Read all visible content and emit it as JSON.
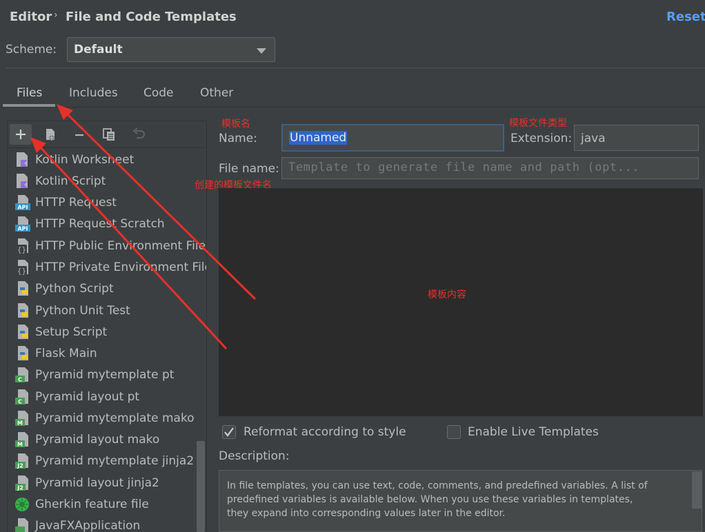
{
  "header": {
    "breadcrumb": [
      "Editor",
      "File and Code Templates"
    ],
    "breadcrumb_separator": "›",
    "reset_label": "Reset"
  },
  "scheme": {
    "label": "Scheme:",
    "value": "Default"
  },
  "tabs": [
    {
      "label": "Files",
      "active": true
    },
    {
      "label": "Includes",
      "active": false
    },
    {
      "label": "Code",
      "active": false
    },
    {
      "label": "Other",
      "active": false
    }
  ],
  "toolbar": {
    "buttons": [
      {
        "name": "add-template-button",
        "glyph": "+"
      },
      {
        "name": "add-child-template-button",
        "glyph": "▟"
      },
      {
        "name": "remove-template-button",
        "glyph": "−"
      },
      {
        "name": "copy-template-button",
        "glyph": "⧉"
      },
      {
        "name": "revert-template-button",
        "glyph": "↶"
      }
    ]
  },
  "templates": [
    {
      "label": "Kotlin Worksheet",
      "icon": "kotlin-file-icon"
    },
    {
      "label": "Kotlin Script",
      "icon": "kotlin-file-icon"
    },
    {
      "label": "HTTP Request",
      "icon": "api-file-icon"
    },
    {
      "label": "HTTP Request Scratch",
      "icon": "api-file-icon"
    },
    {
      "label": "HTTP Public Environment File",
      "icon": "json-file-icon"
    },
    {
      "label": "HTTP Private Environment File",
      "icon": "json-file-icon"
    },
    {
      "label": "Python Script",
      "icon": "python-file-icon"
    },
    {
      "label": "Python Unit Test",
      "icon": "python-file-icon"
    },
    {
      "label": "Setup Script",
      "icon": "python-file-icon"
    },
    {
      "label": "Flask Main",
      "icon": "python-file-icon"
    },
    {
      "label": "Pyramid mytemplate pt",
      "icon": "chameleon-file-icon",
      "badge": "C"
    },
    {
      "label": "Pyramid layout pt",
      "icon": "chameleon-file-icon",
      "badge": "C"
    },
    {
      "label": "Pyramid mytemplate mako",
      "icon": "mako-file-icon",
      "badge": "M"
    },
    {
      "label": "Pyramid layout mako",
      "icon": "mako-file-icon",
      "badge": "M"
    },
    {
      "label": "Pyramid mytemplate jinja2",
      "icon": "jinja2-file-icon",
      "badge": "J2"
    },
    {
      "label": "Pyramid layout jinja2",
      "icon": "jinja2-file-icon",
      "badge": "J2"
    },
    {
      "label": "Gherkin feature file",
      "icon": "gherkin-file-icon"
    },
    {
      "label": "JavaFXApplication",
      "icon": "java-file-icon"
    }
  ],
  "form": {
    "name_label": "Name:",
    "name_value": "Unnamed",
    "extension_label": "Extension:",
    "extension_value": "java",
    "file_name_label": "File name:",
    "file_name_placeholder": "Template to generate file name and path (opt..."
  },
  "options": {
    "reformat_label": "Reformat according to style",
    "reformat_checked": true,
    "live_templates_label": "Enable Live Templates",
    "live_templates_checked": false
  },
  "description": {
    "label": "Description:",
    "lines": [
      "In file templates, you can use text, code, comments, and predefined variables. A list of",
      "predefined variables is available below. When you use these variables in templates,",
      "they expand into corresponding values later in the editor."
    ]
  },
  "annotations": {
    "name": "模板名",
    "extension": "模板文件类型",
    "file_name": "创建的模板文件名",
    "content": "模板内容"
  },
  "colors": {
    "background": "#3c3f41",
    "editor": "#2b2b2b",
    "accent": "#589df6",
    "annotation": "#e8302a"
  }
}
